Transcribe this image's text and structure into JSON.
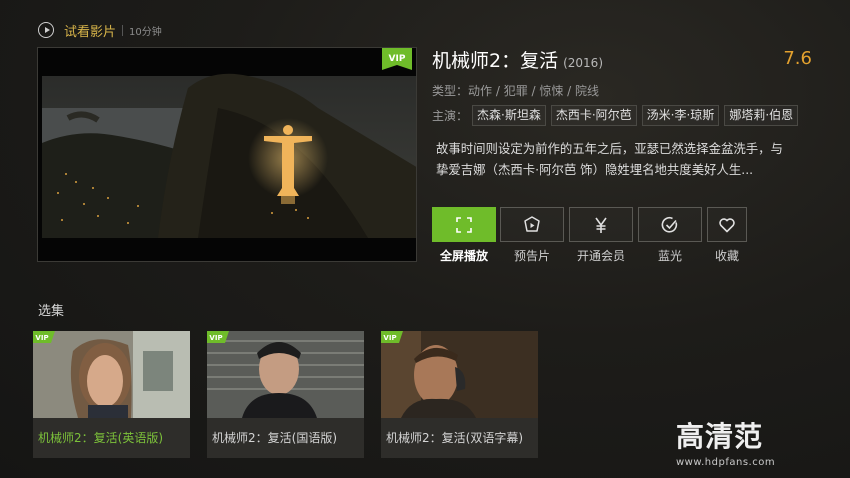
{
  "header": {
    "trial_label": "试看影片",
    "trial_duration": "10分钟"
  },
  "player": {
    "vip_badge": "VIP"
  },
  "movie": {
    "title": "机械师2：复活",
    "year": "(2016)",
    "score": "7.6",
    "genre_label": "类型：",
    "genres": "动作 / 犯罪 / 惊悚 / 院线",
    "cast_label": "主演：",
    "cast": [
      "杰森·斯坦森",
      "杰西卡·阿尔芭",
      "汤米·李·琼斯",
      "娜塔莉·伯恩"
    ],
    "synopsis": "故事时间则设定为前作的五年之后，亚瑟已然选择金盆洗手，与挚爱吉娜（杰西卡·阿尔芭 饰）隐姓埋名地共度美好人生..."
  },
  "actions": [
    {
      "label": "全屏播放",
      "icon": "fullscreen-icon",
      "active": true
    },
    {
      "label": "预告片",
      "icon": "trailer-icon",
      "active": false
    },
    {
      "label": "开通会员",
      "icon": "yuan-icon",
      "active": false
    },
    {
      "label": "蓝光",
      "icon": "bluray-check-icon",
      "active": false
    },
    {
      "label": "收藏",
      "icon": "heart-icon",
      "active": false
    }
  ],
  "episodes": {
    "title": "选集",
    "items": [
      {
        "label": "机械师2：复活(英语版)",
        "badge": "VIP",
        "selected": true
      },
      {
        "label": "机械师2：复活(国语版)",
        "badge": "VIP",
        "selected": false
      },
      {
        "label": "机械师2：复活(双语字幕)",
        "badge": "VIP",
        "selected": false
      }
    ]
  },
  "watermark": {
    "brand": "高清范",
    "url": "www.hdpfans.com"
  },
  "colors": {
    "accent_green": "#6fbc2a",
    "score_orange": "#e3a12e",
    "trial_gold": "#d8b54a"
  }
}
